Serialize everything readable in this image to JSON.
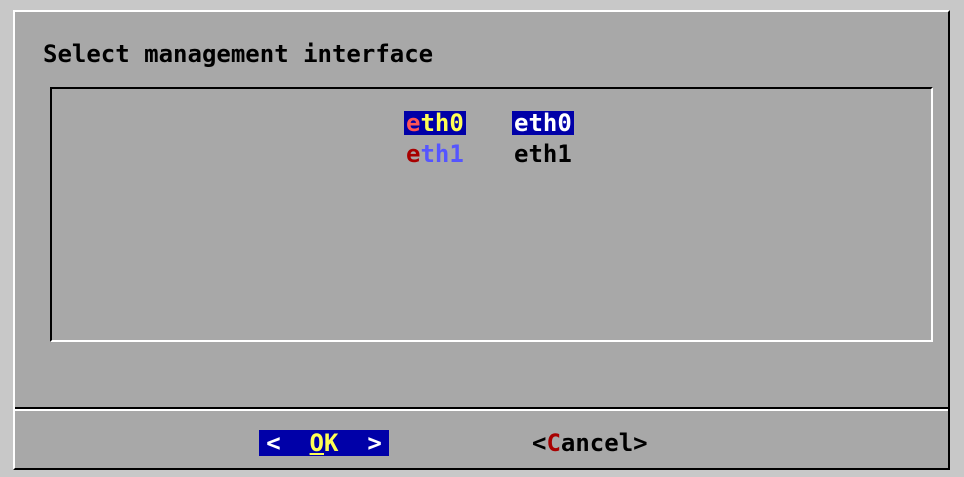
{
  "dialog": {
    "title": "Select management interface"
  },
  "menu": {
    "items": [
      {
        "tag_hotkey": "e",
        "tag_rest": "th0",
        "description": "eth0",
        "selected": true
      },
      {
        "tag_hotkey": "e",
        "tag_rest": "th1",
        "description": "eth1",
        "selected": false
      }
    ]
  },
  "buttons": {
    "ok": {
      "left": "<",
      "hotkey": "O",
      "rest": "K",
      "right": ">"
    },
    "cancel": {
      "left": "<",
      "hotkey": "C",
      "rest": "ancel",
      "right": ">"
    }
  },
  "colors": {
    "dialog_bg": "#a8a8a8",
    "selection_bg": "#0000a8",
    "selected_tag_fg": "#ffff55",
    "unselected_tag_fg": "#5555ff",
    "hotkey_fg": "#ff5555"
  }
}
